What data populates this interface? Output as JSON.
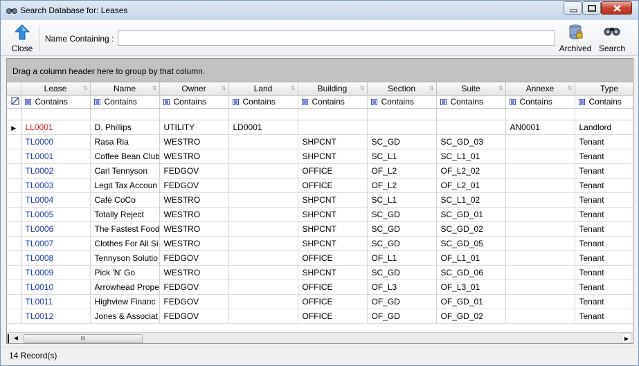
{
  "window": {
    "title": "Search Database for: Leases"
  },
  "toolbar": {
    "close_label": "Close",
    "name_label": "Name Containing :",
    "name_value": "",
    "archived_label": "Archived",
    "search_label": "Search"
  },
  "grid": {
    "group_hint": "Drag a column header here to group by that column.",
    "columns": [
      "Lease",
      "Name",
      "Owner",
      "Land",
      "Building",
      "Section",
      "Suite",
      "Annexe",
      "Type"
    ],
    "filter_label": "Contains",
    "rows": [
      [
        "LL0001",
        "D. Phillips",
        "UTILITY",
        "LD0001",
        "",
        "",
        "",
        "AN0001",
        "Landlord"
      ],
      [
        "TL0000",
        "Rasa Ria",
        "WESTRO",
        "",
        "SHPCNT",
        "SC_GD",
        "SC_GD_03",
        "",
        "Tenant"
      ],
      [
        "TL0001",
        "Coffee Bean Club",
        "WESTRO",
        "",
        "SHPCNT",
        "SC_L1",
        "SC_L1_01",
        "",
        "Tenant"
      ],
      [
        "TL0002",
        "Carl Tennyson",
        "FEDGOV",
        "",
        "OFFICE",
        "OF_L2",
        "OF_L2_02",
        "",
        "Tenant"
      ],
      [
        "TL0003",
        "Legit Tax Accoun",
        "FEDGOV",
        "",
        "OFFICE",
        "OF_L2",
        "OF_L2_01",
        "",
        "Tenant"
      ],
      [
        "TL0004",
        "Café CoCo",
        "WESTRO",
        "",
        "SHPCNT",
        "SC_L1",
        "SC_L1_02",
        "",
        "Tenant"
      ],
      [
        "TL0005",
        "Totally Reject",
        "WESTRO",
        "",
        "SHPCNT",
        "SC_GD",
        "SC_GD_01",
        "",
        "Tenant"
      ],
      [
        "TL0006",
        "The Fastest Food",
        "WESTRO",
        "",
        "SHPCNT",
        "SC_GD",
        "SC_GD_02",
        "",
        "Tenant"
      ],
      [
        "TL0007",
        "Clothes For All Si",
        "WESTRO",
        "",
        "SHPCNT",
        "SC_GD",
        "SC_GD_05",
        "",
        "Tenant"
      ],
      [
        "TL0008",
        "Tennyson Solutio",
        "FEDGOV",
        "",
        "OFFICE",
        "OF_L1",
        "OF_L1_01",
        "",
        "Tenant"
      ],
      [
        "TL0009",
        "Pick 'N' Go",
        "WESTRO",
        "",
        "SHPCNT",
        "SC_GD",
        "SC_GD_06",
        "",
        "Tenant"
      ],
      [
        "TL0010",
        "Arrowhead Prope",
        "FEDGOV",
        "",
        "OFFICE",
        "OF_L3",
        "OF_L3_01",
        "",
        "Tenant"
      ],
      [
        "TL0011",
        "Highview Financ",
        "FEDGOV",
        "",
        "OFFICE",
        "OF_GD",
        "OF_GD_01",
        "",
        "Tenant"
      ],
      [
        "TL0012",
        "Jones & Associat",
        "FEDGOV",
        "",
        "OFFICE",
        "OF_GD",
        "OF_GD_02",
        "",
        "Tenant"
      ]
    ],
    "scroll_thumb_glyph": "III"
  },
  "status": {
    "records": "14 Record(s)"
  },
  "colors": {
    "lease_link": "#1a3bb3",
    "lease_current": "#d62020",
    "group_panel": "#c2c2c2"
  },
  "icons": {
    "app": "binoculars-icon",
    "close": "up-arrow-icon",
    "archived": "database-lock-icon",
    "search": "binoculars-icon"
  }
}
